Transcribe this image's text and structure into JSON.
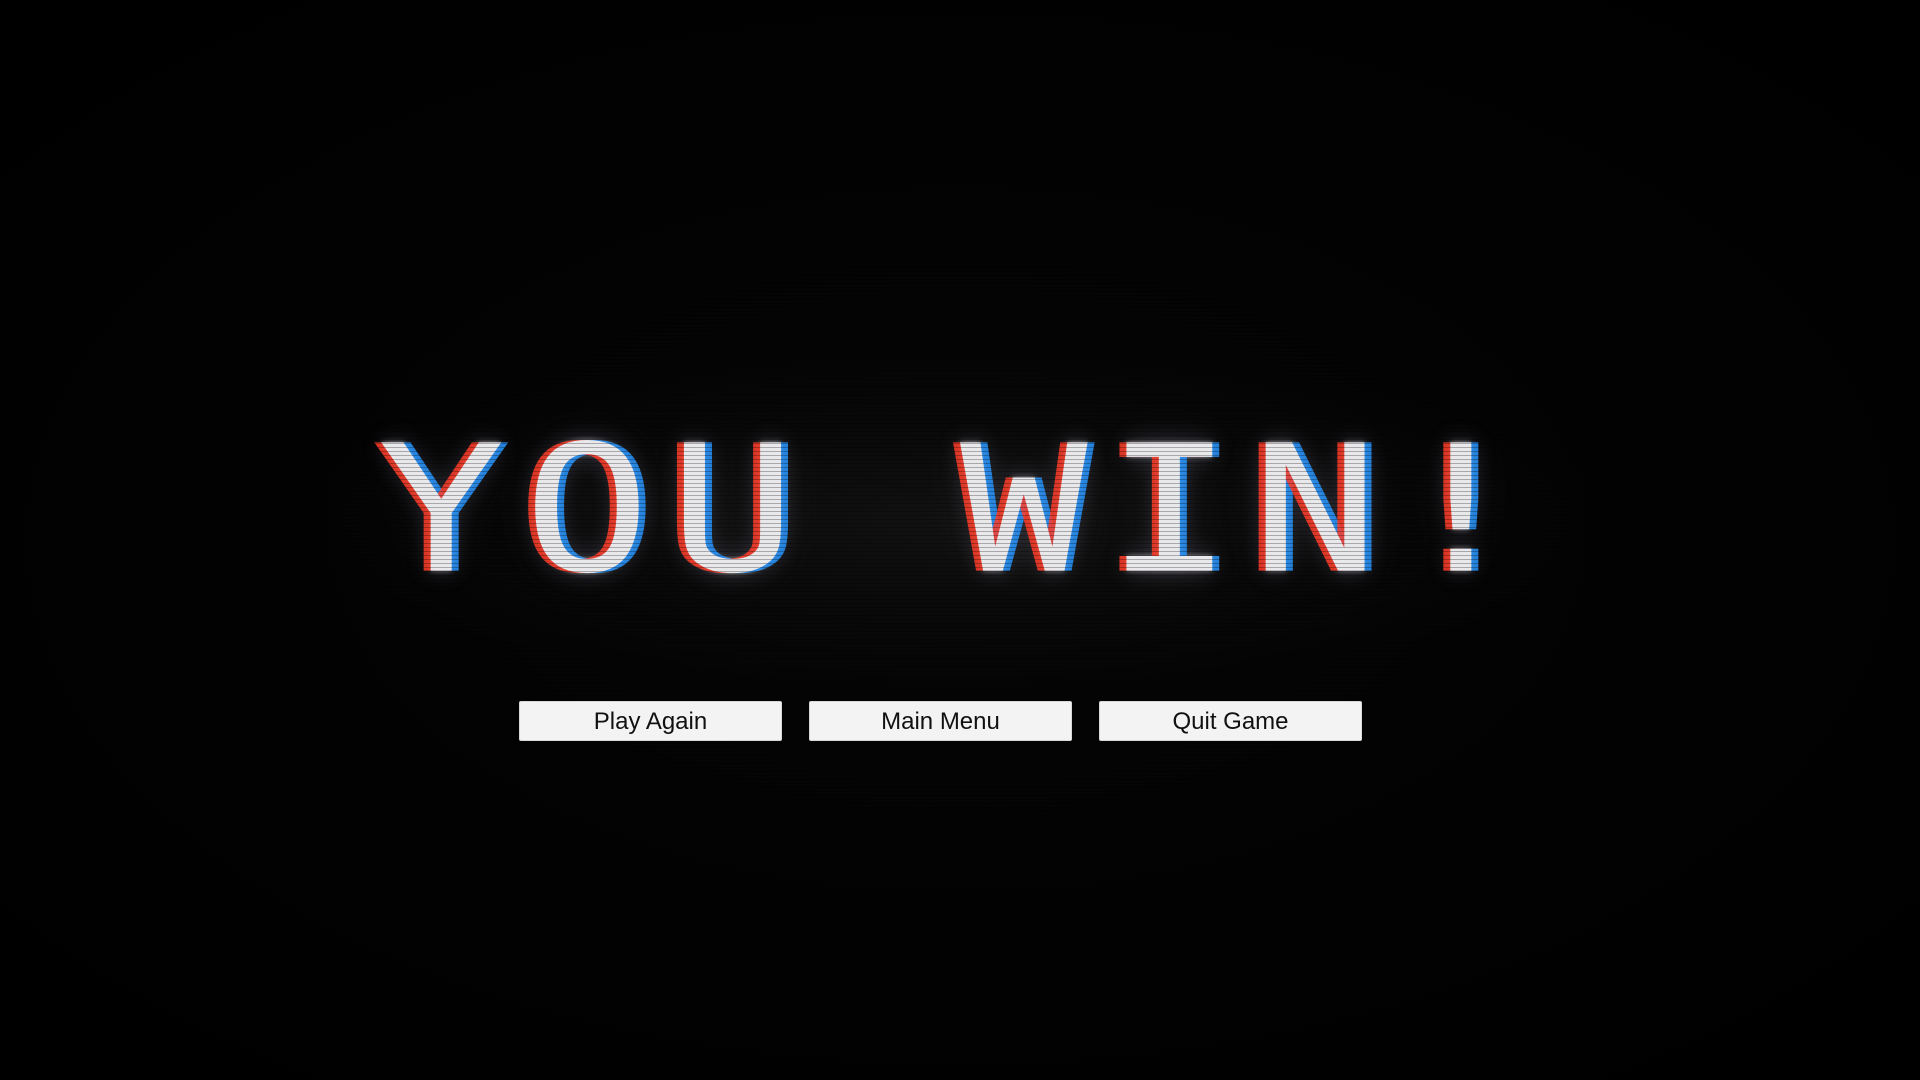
{
  "screen": {
    "title": "YOU WIN!",
    "background_color": "#000000"
  },
  "buttons": {
    "play_again": "Play Again",
    "main_menu": "Main Menu",
    "quit_game": "Quit Game",
    "background_color": "#f3f3f3",
    "text_color": "#111111"
  }
}
